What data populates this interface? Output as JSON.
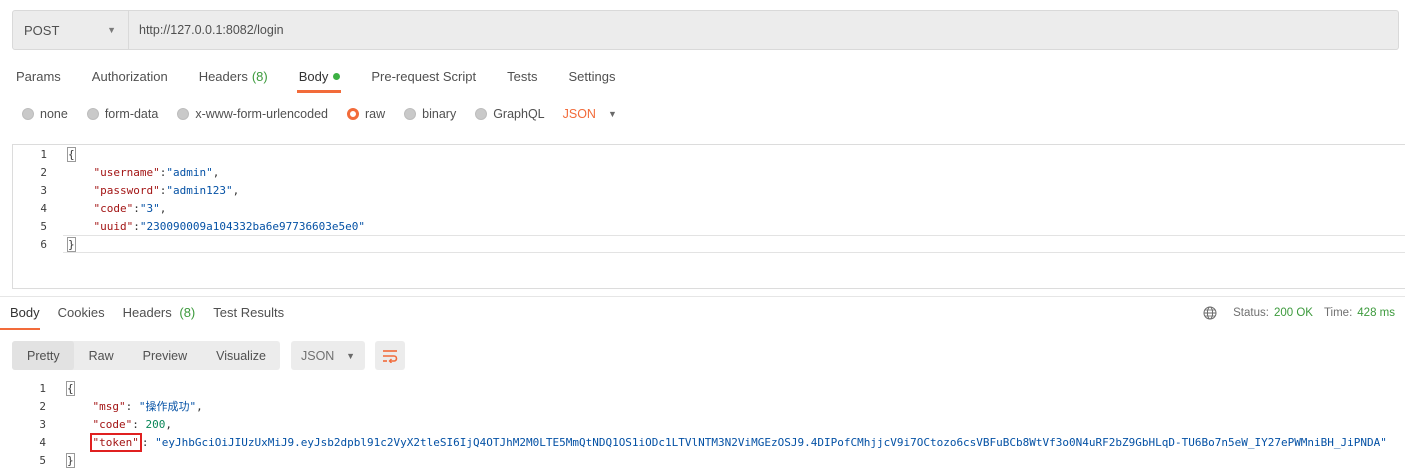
{
  "request": {
    "method": "POST",
    "url": "http://127.0.0.1:8082/login"
  },
  "request_tabs": [
    {
      "label": "Params"
    },
    {
      "label": "Authorization"
    },
    {
      "label": "Headers",
      "count": "(8)"
    },
    {
      "label": "Body"
    },
    {
      "label": "Pre-request Script"
    },
    {
      "label": "Tests"
    },
    {
      "label": "Settings"
    }
  ],
  "body_types": [
    {
      "label": "none"
    },
    {
      "label": "form-data"
    },
    {
      "label": "x-www-form-urlencoded"
    },
    {
      "label": "raw",
      "selected": true
    },
    {
      "label": "binary"
    },
    {
      "label": "GraphQL"
    }
  ],
  "body_format": "JSON",
  "request_body": {
    "line_numbers": [
      "1",
      "2",
      "3",
      "4",
      "5",
      "6"
    ],
    "open_brace": "{",
    "close_brace": "}",
    "fields": [
      {
        "key": "\"username\"",
        "sep": ":",
        "value": "\"admin\"",
        "trail": ","
      },
      {
        "key": "\"password\"",
        "sep": ":",
        "value": "\"admin123\"",
        "trail": ","
      },
      {
        "key": "\"code\"",
        "sep": ":",
        "value": "\"3\"",
        "trail": ","
      },
      {
        "key": "\"uuid\"",
        "sep": ":",
        "value": "\"230090009a104332ba6e97736603e5e0\"",
        "trail": ""
      }
    ]
  },
  "response_tabs": [
    {
      "label": "Body"
    },
    {
      "label": "Cookies"
    },
    {
      "label": "Headers",
      "count": "(8)"
    },
    {
      "label": "Test Results"
    }
  ],
  "status": {
    "status_label": "Status:",
    "status_value": "200 OK",
    "time_label": "Time:",
    "time_value": "428 ms"
  },
  "view_modes": [
    "Pretty",
    "Raw",
    "Preview",
    "Visualize"
  ],
  "response_format": "JSON",
  "response_body": {
    "line_numbers": [
      "1",
      "2",
      "3",
      "4",
      "5"
    ],
    "open_brace": "{",
    "close_brace": "}",
    "msg_key": "\"msg\"",
    "msg_value": "\"操作成功\"",
    "code_key": "\"code\"",
    "code_value": "200",
    "token_key": "\"token\"",
    "token_value": "\"eyJhbGciOiJIUzUxMiJ9.eyJsb2dpbl91c2VyX2tleSI6IjQ4OTJhM2M0LTE5MmQtNDQ1OS1iODc1LTVlNTM3N2ViMGEzOSJ9.4DIPofCMhjjcV9i7OCtozo6csVBFuBCb8WtVf3o0N4uRF2bZ9GbHLqD-TU6Bo7n5eW_IY27ePWMniBH_JiPNDA\""
  },
  "colors": {
    "accent": "#f26b3a",
    "success": "#3c9a3c",
    "highlight_box": "#e02020"
  }
}
